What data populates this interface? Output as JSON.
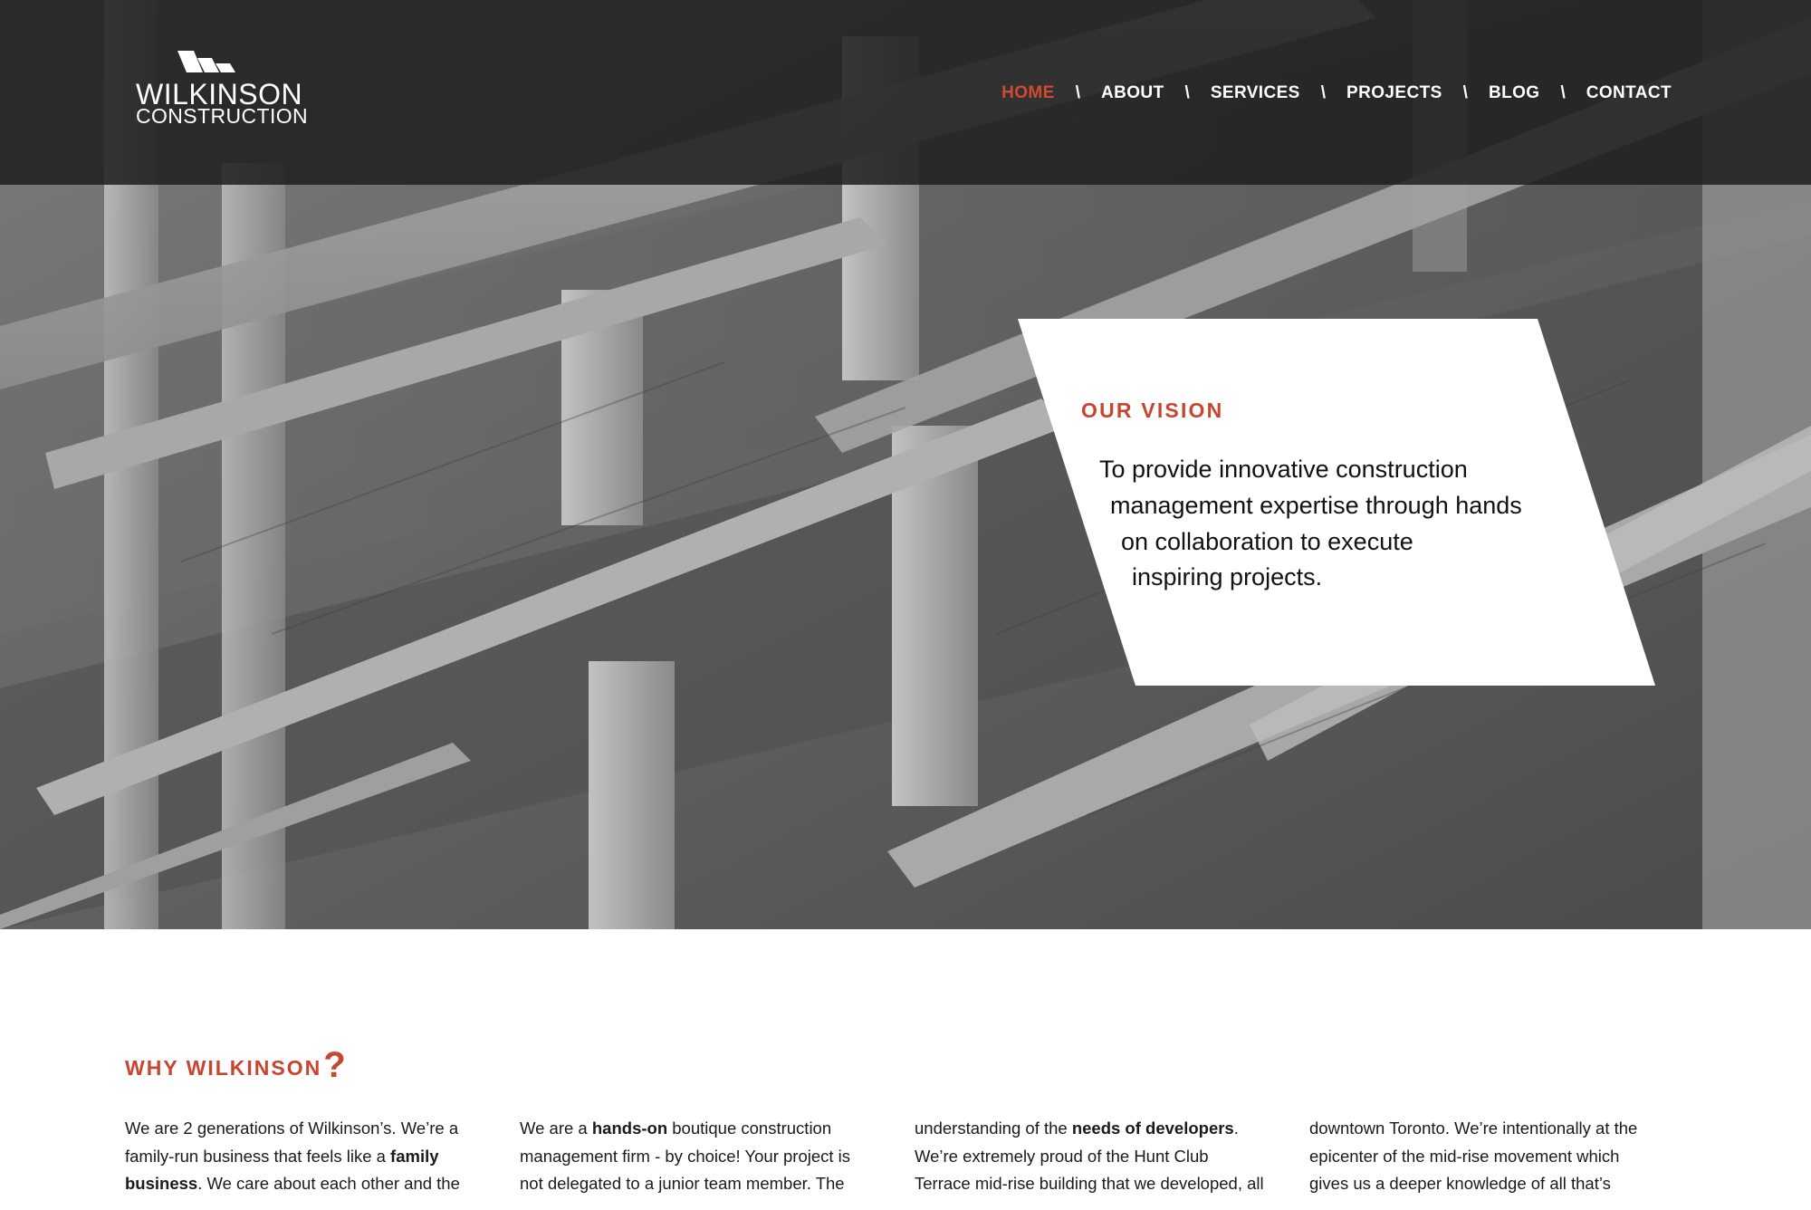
{
  "brand": {
    "name": "WILKINSON",
    "subtitle": "CONSTRUCTION",
    "logo_icon": "stacked-slab-logo-mark"
  },
  "nav": {
    "items": [
      {
        "label": "HOME",
        "active": true
      },
      {
        "label": "ABOUT",
        "active": false
      },
      {
        "label": "SERVICES",
        "active": false
      },
      {
        "label": "PROJECTS",
        "active": false
      },
      {
        "label": "BLOG",
        "active": false
      },
      {
        "label": "CONTACT",
        "active": false
      }
    ],
    "separator": "\\"
  },
  "hero": {
    "background": "grayscale photo of concrete building frame under construction",
    "vision_title": "OUR VISION",
    "vision_lines": [
      "To provide innovative construction",
      "management expertise through hands",
      "on collaboration to execute",
      "inspiring projects."
    ]
  },
  "why": {
    "title": "WHY WILKINSON",
    "title_mark": "?",
    "columns": [
      {
        "lines": [
          [
            {
              "t": "We are 2 generations of Wilkinson’s. We’re a"
            }
          ],
          [
            {
              "t": "family-run business that feels like a "
            },
            {
              "t": "family",
              "b": true
            }
          ],
          [
            {
              "t": "business",
              "b": true
            },
            {
              "t": ". We care about each other and the"
            }
          ]
        ]
      },
      {
        "lines": [
          [
            {
              "t": "We are a "
            },
            {
              "t": "hands-on",
              "b": true
            },
            {
              "t": " boutique construction"
            }
          ],
          [
            {
              "t": "management firm - by choice! Your project is"
            }
          ],
          [
            {
              "t": "not delegated to a junior team member. The"
            }
          ]
        ]
      },
      {
        "lines": [
          [
            {
              "t": "understanding of the "
            },
            {
              "t": "needs of developers",
              "b": true
            },
            {
              "t": "."
            }
          ],
          [
            {
              "t": "We’re extremely proud of the Hunt Club"
            }
          ],
          [
            {
              "t": "Terrace mid-rise building that we developed, all"
            }
          ]
        ]
      },
      {
        "lines": [
          [
            {
              "t": "downtown Toronto. We’re intentionally at the"
            }
          ],
          [
            {
              "t": "epicenter of the mid-rise movement which"
            }
          ],
          [
            {
              "t": "gives us a deeper knowledge of all that’s"
            }
          ]
        ]
      }
    ]
  },
  "colors": {
    "accent": "#c9452f",
    "header_bg": "#1e1e20",
    "text": "#1a1a1a"
  }
}
